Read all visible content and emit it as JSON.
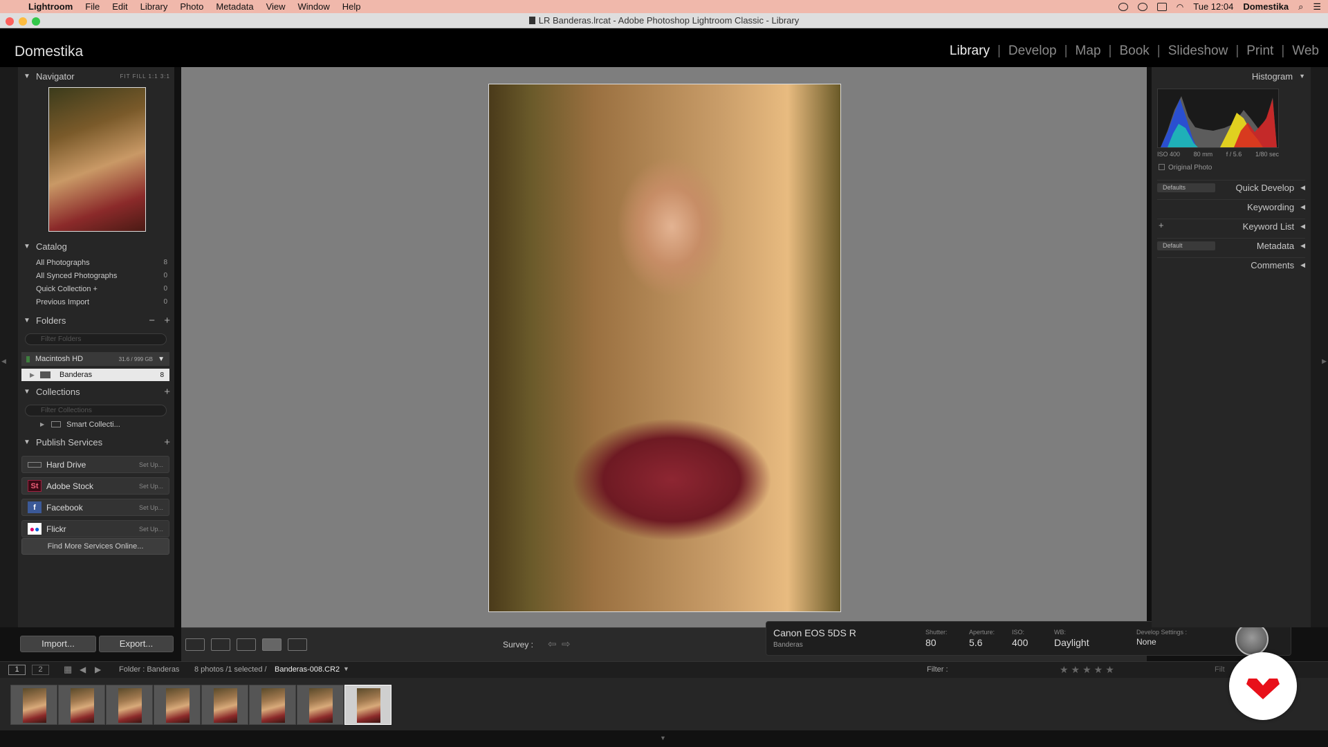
{
  "menubar": {
    "app": "Lightroom",
    "items": [
      "File",
      "Edit",
      "Library",
      "Photo",
      "Metadata",
      "View",
      "Window",
      "Help"
    ],
    "clock": "Tue 12:04",
    "user": "Domestika"
  },
  "window": {
    "title": "LR Banderas.lrcat - Adobe Photoshop Lightroom Classic - Library"
  },
  "identity": {
    "brand": "Domestika"
  },
  "modules": [
    {
      "label": "Library",
      "active": true
    },
    {
      "label": "Develop"
    },
    {
      "label": "Map"
    },
    {
      "label": "Book"
    },
    {
      "label": "Slideshow"
    },
    {
      "label": "Print"
    },
    {
      "label": "Web"
    }
  ],
  "navigator": {
    "title": "Navigator",
    "zoom": "FIT  FILL  1:1  3:1"
  },
  "catalog": {
    "title": "Catalog",
    "items": [
      {
        "label": "All Photographs",
        "count": "8"
      },
      {
        "label": "All Synced Photographs",
        "count": "0"
      },
      {
        "label": "Quick Collection +",
        "count": "0"
      },
      {
        "label": "Previous Import",
        "count": "0"
      }
    ]
  },
  "folders": {
    "title": "Folders",
    "search_placeholder": "Filter Folders",
    "volume": "Macintosh HD",
    "volume_size": "31.6 / 999 GB",
    "folder": "Banderas",
    "folder_count": "8"
  },
  "collections": {
    "title": "Collections",
    "search_placeholder": "Filter Collections",
    "item": "Smart Collecti..."
  },
  "publish": {
    "title": "Publish Services",
    "services": [
      {
        "label": "Hard Drive",
        "setup": "Set Up..."
      },
      {
        "label": "Adobe Stock",
        "setup": "Set Up..."
      },
      {
        "label": "Facebook",
        "setup": "Set Up..."
      },
      {
        "label": "Flickr",
        "setup": "Set Up..."
      }
    ],
    "find_more": "Find More Services Online..."
  },
  "buttons": {
    "import": "Import...",
    "export": "Export..."
  },
  "toolbar": {
    "survey": "Survey :"
  },
  "camera": {
    "model": "Canon EOS 5DS R",
    "folder": "Banderas",
    "shutter_label": "Shutter:",
    "shutter": "80",
    "aperture_label": "Aperture:",
    "aperture": "5.6",
    "iso_label": "ISO:",
    "iso": "400",
    "wb_label": "WB:",
    "wb": "Daylight",
    "develop_label": "Develop Settings :",
    "develop": "None"
  },
  "histogram": {
    "title": "Histogram",
    "iso": "ISO 400",
    "focal": "80 mm",
    "fstop": "f / 5.6",
    "shutter": "1/80 sec",
    "original": "Original Photo"
  },
  "right_panels": {
    "quick_develop": "Quick Develop",
    "keywording": "Keywording",
    "keyword_list": "Keyword List",
    "metadata": "Metadata",
    "comments": "Comments",
    "defaults": "Defaults",
    "default": "Default"
  },
  "filmstrip": {
    "page1": "1",
    "page2": "2",
    "source": "Folder : Banderas",
    "info": "8 photos /1 selected /",
    "filename": "Banderas-008.CR2",
    "filter": "Filter :",
    "filter_btn": "Filt",
    "thumbs": 8,
    "selected_index": 7
  }
}
